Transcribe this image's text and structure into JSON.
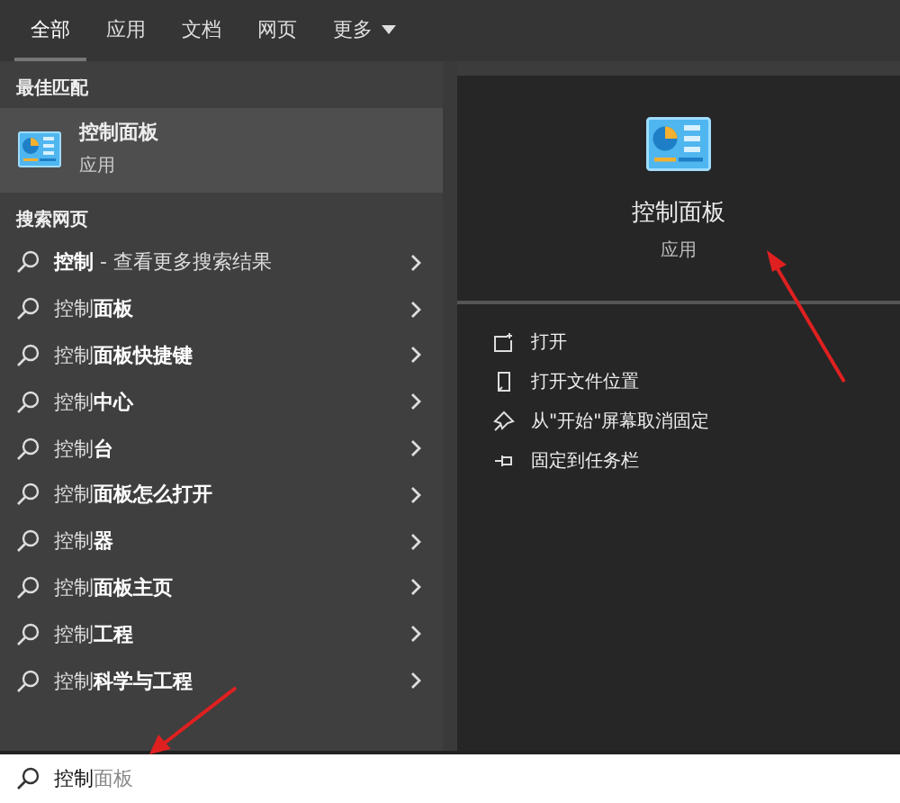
{
  "tabs": [
    {
      "label": "全部",
      "selected": true
    },
    {
      "label": "应用",
      "selected": false
    },
    {
      "label": "文档",
      "selected": false
    },
    {
      "label": "网页",
      "selected": false
    },
    {
      "label": "更多",
      "selected": false,
      "kind": "dropdown"
    }
  ],
  "best_match": {
    "heading": "最佳匹配",
    "name": "控制面板",
    "type": "应用",
    "selected": true
  },
  "web": {
    "heading": "搜索网页",
    "items": [
      {
        "text": "**控制** - 查看更多搜索结果"
      },
      {
        "text": "控制**面板**"
      },
      {
        "text": "控制**面板快捷键**"
      },
      {
        "text": "控制**中心**"
      },
      {
        "text": "控制**台**"
      },
      {
        "text": "控制**面板怎么打开**"
      },
      {
        "text": "控制**器**"
      },
      {
        "text": "控制**面板主页**"
      },
      {
        "text": "控制**工程**"
      },
      {
        "text": "控制**科学与工程**"
      }
    ]
  },
  "detail": {
    "name": "控制面板",
    "type": "应用",
    "actions": [
      {
        "label": "打开",
        "kind": "open"
      },
      {
        "label": "打开文件位置",
        "kind": "location"
      },
      {
        "label": "从\"开始\"屏幕取消固定",
        "kind": "unpin"
      },
      {
        "label": "固定到任务栏",
        "kind": "pin"
      }
    ]
  },
  "search": {
    "value": "控制",
    "suggestion": "面板"
  }
}
